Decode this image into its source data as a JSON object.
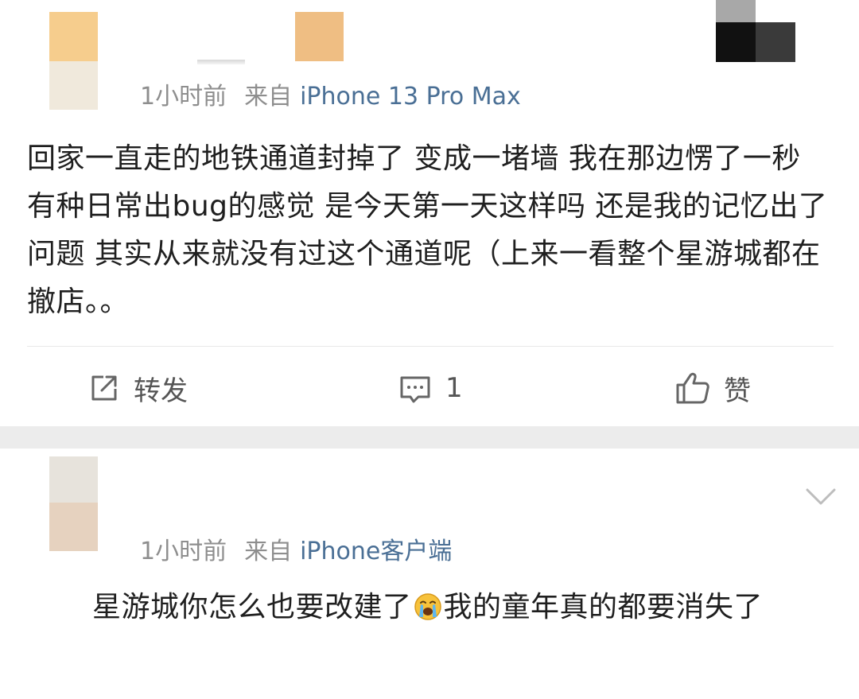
{
  "posts": [
    {
      "meta": {
        "time": "1小时前",
        "from_label": "来自",
        "device": "iPhone 13 Pro Max"
      },
      "content": "回家一直走的地铁通道封掉了 变成一堵墙 我在那边愣了一秒 有种日常出bug的感觉 是今天第一天这样吗 还是我的记忆出了问题 其实从来就没有过这个通道呢（上来一看整个星游城都在撤店。。",
      "actions": {
        "forward_label": "转发",
        "comment_count": "1",
        "like_label": "赞"
      }
    },
    {
      "meta": {
        "time": "1小时前",
        "from_label": "来自",
        "device": "iPhone客户端"
      },
      "content_before_emoji": "星游城你怎么也要改建了",
      "emoji": "crying-face-icon",
      "content_after_emoji": "我的童年真的都要消失了"
    }
  ],
  "colors": {
    "meta_gray": "#8e8e8e",
    "device_blue": "#4a6f95",
    "text": "#1f1f1f",
    "separator_band": "#ececec"
  }
}
